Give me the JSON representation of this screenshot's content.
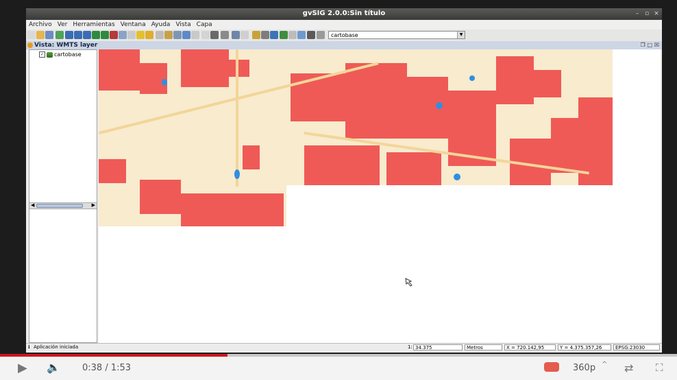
{
  "window": {
    "title": "gvSIG 2.0.0:Sin título"
  },
  "menu": [
    "Archivo",
    "Ver",
    "Herramientas",
    "Ventana",
    "Ayuda",
    "Vista",
    "Capa"
  ],
  "toolbar": {
    "layer_combo": "cartobase"
  },
  "view": {
    "title": "Vista: WMTS layer",
    "window_buttons": "❐ □ ☒"
  },
  "toc": {
    "layers": [
      {
        "name": "cartobase",
        "checked": true
      }
    ]
  },
  "status": {
    "message": "Aplicación iniciada",
    "scale_prefix": "1:",
    "scale": "34.375",
    "units": "Metros",
    "x": "X = 720.142,95",
    "y": "Y = 4.375.357,26",
    "crs": "EPSG:23030"
  },
  "player": {
    "time": "0:38 / 1:53",
    "quality": "360p",
    "progress_fraction": 0.336,
    "icons": [
      "play-icon",
      "volume-icon",
      "comment-icon",
      "quality-icon",
      "loop-icon",
      "fullscreen-icon"
    ]
  },
  "colors": {
    "map_bg": "#f8ebce",
    "urban": "#ef5a57",
    "water": "#2f8fe0",
    "roads": "#f3d59a",
    "progress": "#cc181e"
  }
}
